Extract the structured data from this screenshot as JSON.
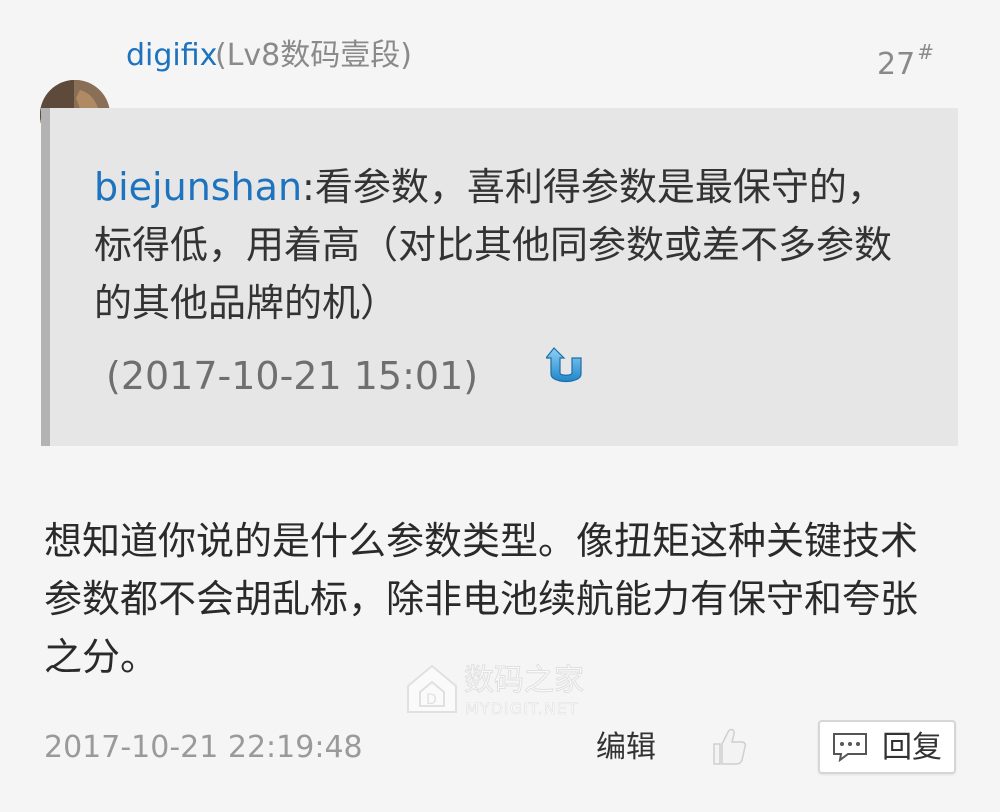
{
  "post": {
    "author": {
      "name": "digifix",
      "level": "(Lv8数码壹段)"
    },
    "floor": {
      "number": "27",
      "mark": "#"
    },
    "quote": {
      "user": "biejunshan",
      "text": ":看参数，喜利得参数是最保守的，标得低，用着高（对比其他同参数或差不多参数的其他品牌的机）",
      "time": "(2017-10-21 15:01)"
    },
    "content": "想知道你说的是什么参数类型。像扭矩这种关键技术参数都不会胡乱标，除非电池续航能力有保守和夸张之分。",
    "watermark": {
      "main": "数码之家",
      "sub": "MYDIGIT.NET"
    },
    "footer": {
      "time": "2017-10-21 22:19:48",
      "edit_label": "编辑",
      "reply_label": "回复"
    }
  },
  "colors": {
    "username": "#1d73bd",
    "quote_bg": "#e6e6e6",
    "quote_bar": "#b3b3b3",
    "muted": "#9a9a9a"
  },
  "icons": {
    "jump": "jump-to-quote-icon",
    "like": "thumbs-up-icon",
    "reply": "comment-bubble-icon",
    "logo": "house-logo-icon"
  }
}
